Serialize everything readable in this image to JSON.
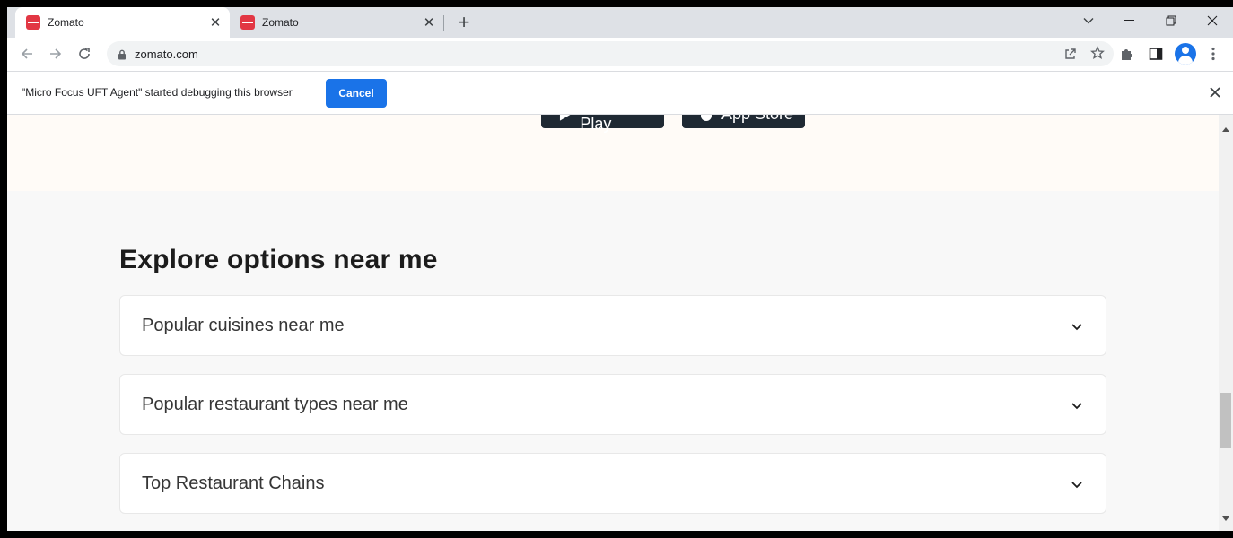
{
  "tabs": [
    {
      "title": "Zomato",
      "active": true
    },
    {
      "title": "Zomato",
      "active": false
    }
  ],
  "tab_close_glyph": "✕",
  "new_tab_glyph": "+",
  "address_bar": {
    "url": "zomato.com"
  },
  "infobar": {
    "message": "\"Micro Focus UFT Agent\" started debugging this browser",
    "cancel_label": "Cancel"
  },
  "store_buttons": {
    "google_play": "Google Play",
    "app_store": "App Store"
  },
  "section": {
    "title": "Explore options near me",
    "items": [
      {
        "label": "Popular cuisines near me"
      },
      {
        "label": "Popular restaurant types near me"
      },
      {
        "label": "Top Restaurant Chains"
      }
    ]
  },
  "colors": {
    "brand": "#e23744",
    "accent": "#1a73e8",
    "tabstrip": "#dee1e6",
    "page_bg": "#f8f8f8"
  },
  "scroll_position_fraction": 0.83
}
